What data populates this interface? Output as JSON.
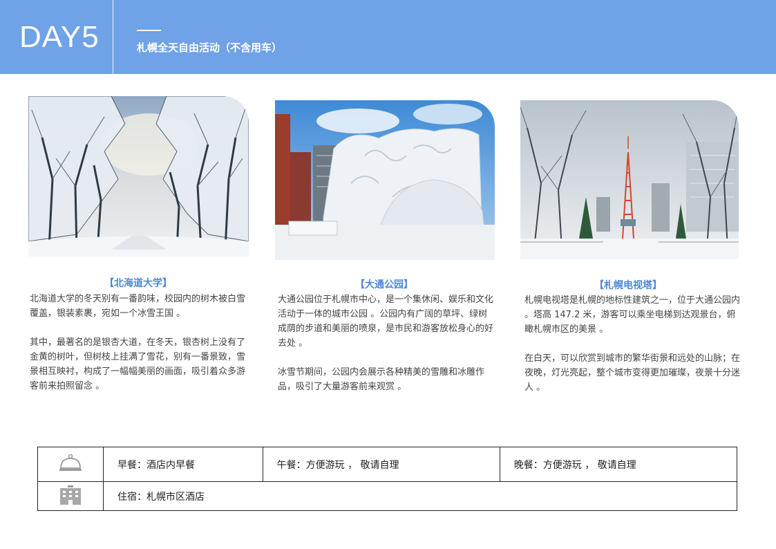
{
  "header": {
    "day": "DAY5",
    "subtitle": "札幌全天自由活动（不含用车）"
  },
  "cards": [
    {
      "title": "【北海道大学】",
      "paragraphs": [
        "北海道大学的冬天别有一番韵味，校园内的树木被白雪覆盖，银装素裹，宛如一个冰雪王国 。",
        "其中，最著名的是银杏大道，在冬天，银杏树上没有了金黄的树叶，但树枝上挂满了雪花，别有一番景致，雪景相互映衬，构成了一幅幅美丽的画面，吸引着众多游客前来拍照留念 。"
      ]
    },
    {
      "title": "【大通公园】",
      "paragraphs": [
        "大通公园位于札幌市中心，是一个集休闲、娱乐和文化活动于一体的城市公园 。公园内有广阔的草坪、绿树成荫的步道和美丽的喷泉，是市民和游客放松身心的好去处 。",
        "冰雪节期间，公园内会展示各种精美的雪雕和冰雕作品，吸引了大量游客前来观赏 。"
      ]
    },
    {
      "title": "【札幌电视塔】",
      "paragraphs": [
        "札幌电视塔是札幌的地标性建筑之一，位于大通公园内 。塔高 147.2 米，游客可以乘坐电梯到达观景台，俯瞰札幌市区的美景 。",
        "在白天，可以欣赏到城市的繁华街景和远处的山脉；在夜晚，灯光亮起，整个城市变得更加璀璨，夜景十分迷人 。"
      ]
    }
  ],
  "table": {
    "breakfast": "早餐：酒店内早餐",
    "lunch": "午餐：方便游玩 ， 敬请自理",
    "dinner": "晚餐：方便游玩 ， 敬请自理",
    "hotel": "住宿：札幌市区酒店"
  },
  "colors": {
    "header_bg": "#6fa2e6",
    "title_blue": "#4d88d4"
  }
}
